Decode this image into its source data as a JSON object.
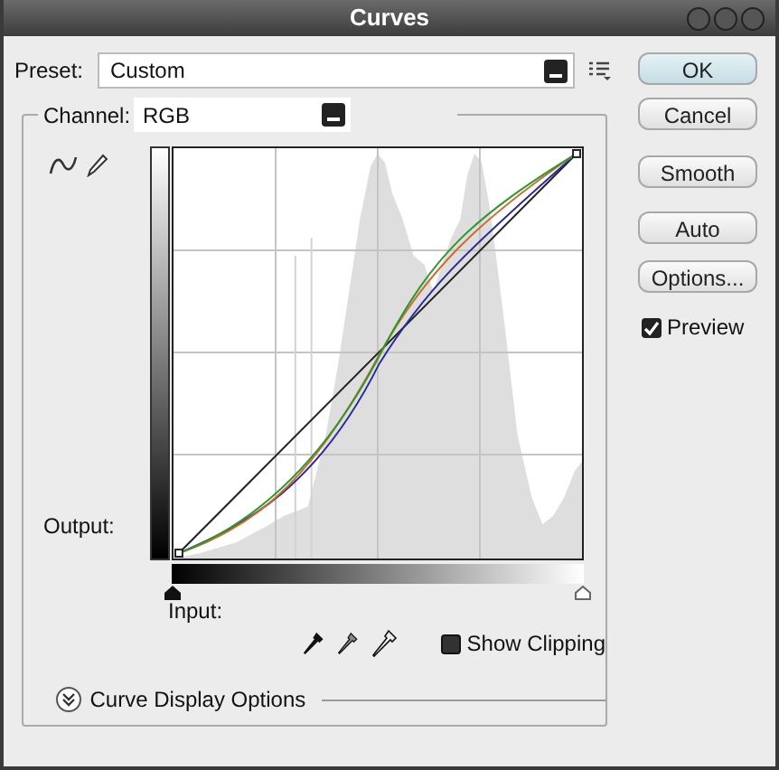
{
  "window": {
    "title": "Curves"
  },
  "preset": {
    "label": "Preset:",
    "value": "Custom"
  },
  "channel": {
    "label": "Channel:",
    "value": "RGB"
  },
  "output_label": "Output:",
  "input_label": "Input:",
  "show_clipping": {
    "label": "Show Clipping",
    "checked": false
  },
  "display_options": {
    "label": "Curve Display Options",
    "expanded": false
  },
  "buttons": [
    {
      "label": "OK",
      "kind": "default"
    },
    {
      "label": "Cancel",
      "kind": "normal"
    },
    {
      "label": "Smooth",
      "kind": "normal"
    },
    {
      "label": "Auto",
      "kind": "normal"
    },
    {
      "label": "Options...",
      "kind": "normal"
    }
  ],
  "preview": {
    "label": "Preview",
    "checked": true
  }
}
